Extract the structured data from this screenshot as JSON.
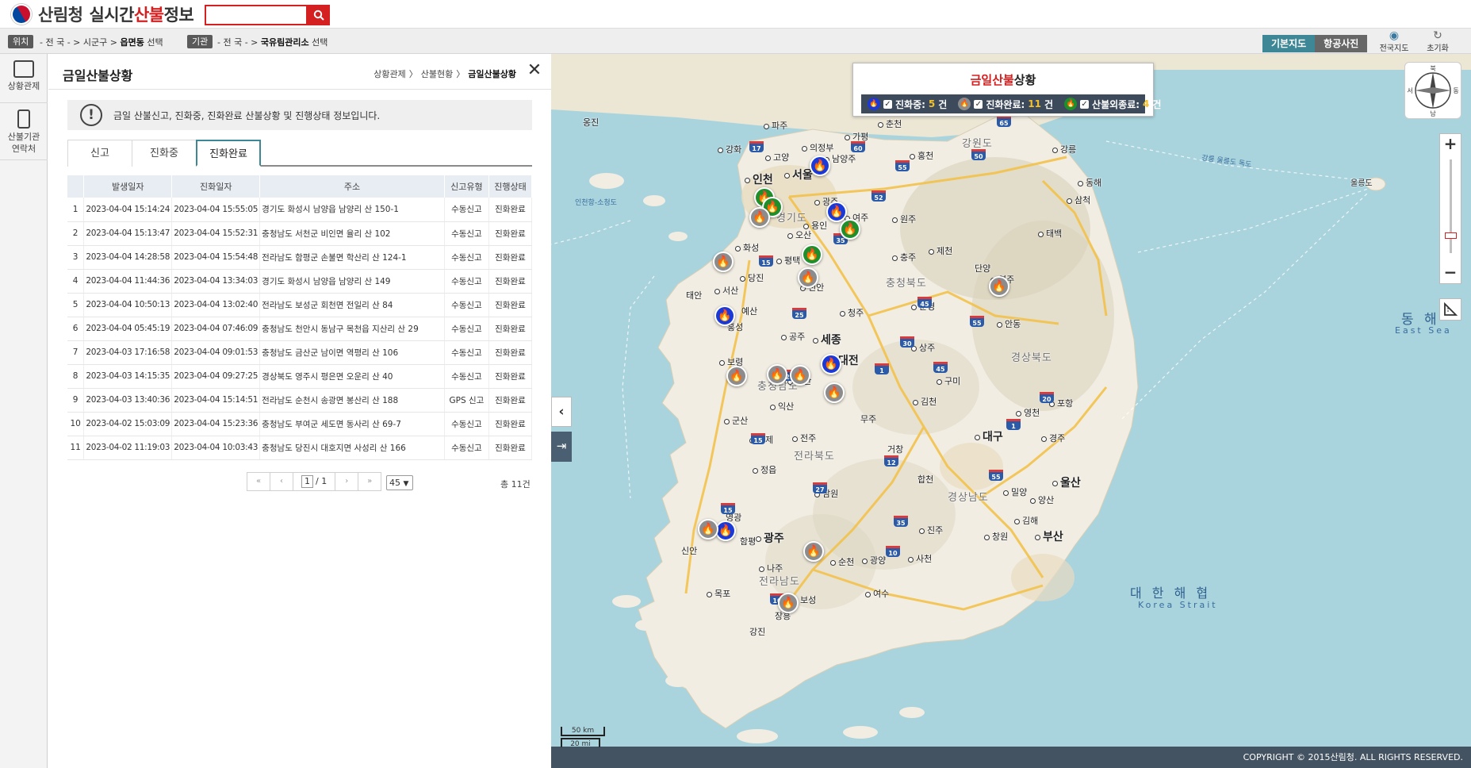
{
  "header": {
    "org": "산림청",
    "title_pre": "실시간",
    "title_red": "산불",
    "title_post": "정보",
    "search_placeholder": ""
  },
  "location_bar": {
    "location_tag": "위치",
    "location_text": "- 전 국 - > 시군구 > ",
    "location_bold": "읍면동",
    "location_suffix": " 선택",
    "agency_tag": "기관",
    "agency_text": "- 전 국 - > ",
    "agency_bold": "국유림관리소",
    "agency_suffix": " 선택",
    "map_basic": "기본지도",
    "map_aerial": "항공사진",
    "national_map": "전국지도",
    "reset": "초기화"
  },
  "left_nav": {
    "item1": "상황관제",
    "item2_line1": "산불기관",
    "item2_line2": "연락처"
  },
  "panel": {
    "title": "금일산불상황",
    "breadcrumb": [
      "상황관제",
      "산불현황",
      "금일산불상황"
    ],
    "notice": "금일 산불신고, 진화중, 진화완료 산불상황 및 진행상태 정보입니다.",
    "tabs": [
      "신고",
      "진화중",
      "진화완료"
    ],
    "active_tab": "진화완료",
    "columns": [
      "",
      "발생일자",
      "진화일자",
      "주소",
      "신고유형",
      "진행상태"
    ],
    "rows": [
      [
        "1",
        "2023-04-04 15:14:24",
        "2023-04-04 15:55:05",
        "경기도 화성시 남양읍 남양리 산 150-1",
        "수동신고",
        "진화완료"
      ],
      [
        "2",
        "2023-04-04 15:13:47",
        "2023-04-04 15:52:31",
        "충청남도 서천군 비인면 율리 산 102",
        "수동신고",
        "진화완료"
      ],
      [
        "3",
        "2023-04-04 14:28:58",
        "2023-04-04 15:54:48",
        "전라남도 함평군 손불면 학산리 산 124-1",
        "수동신고",
        "진화완료"
      ],
      [
        "4",
        "2023-04-04 11:44:36",
        "2023-04-04 13:34:03",
        "경기도 화성시 남양읍 남양리 산 149",
        "수동신고",
        "진화완료"
      ],
      [
        "5",
        "2023-04-04 10:50:13",
        "2023-04-04 13:02:40",
        "전라남도 보성군 회천면 전일리 산 84",
        "수동신고",
        "진화완료"
      ],
      [
        "6",
        "2023-04-04 05:45:19",
        "2023-04-04 07:46:09",
        "충청남도 천안시 동남구 목천읍 지산리 산 29",
        "수동신고",
        "진화완료"
      ],
      [
        "7",
        "2023-04-03 17:16:58",
        "2023-04-04 09:01:53",
        "충청남도 금산군 남이면 역평리 산 106",
        "수동신고",
        "진화완료"
      ],
      [
        "8",
        "2023-04-03 14:15:35",
        "2023-04-04 09:27:25",
        "경상북도 영주시 평은면 오운리 산 40",
        "수동신고",
        "진화완료"
      ],
      [
        "9",
        "2023-04-03 13:40:36",
        "2023-04-04 15:14:51",
        "전라남도 순천시 송광면 봉산리 산 188",
        "GPS 신고",
        "진화완료"
      ],
      [
        "10",
        "2023-04-02 15:03:09",
        "2023-04-04 15:23:36",
        "충청남도 부여군 세도면 동사리 산 69-7",
        "수동신고",
        "진화완료"
      ],
      [
        "11",
        "2023-04-02 11:19:03",
        "2023-04-04 10:03:43",
        "충청남도 당진시 대호지면 사성리 산 166",
        "수동신고",
        "진화완료"
      ]
    ],
    "pager": {
      "current": "1",
      "total_pages": "/ 1",
      "page_size": "45",
      "total_label": "총 11건"
    }
  },
  "map": {
    "legend": {
      "title_red": "금일산불",
      "title_post": "상황",
      "active_label": "진화중: ",
      "active_count": "5",
      "done_label": "진화완료: ",
      "done_count": "11",
      "other_label": "산불외종료: ",
      "other_count": "4",
      "unit": "건"
    },
    "compass_labels": [
      "북",
      "서",
      "동",
      "남"
    ],
    "scale_km": "50 km",
    "scale_mi": "20 mi",
    "copyright": "COPYRIGHT © 2015산림청. ALL RIGHTS RESERVED.",
    "colors": {
      "active": "#1a39d6",
      "done": "#8c8c8c",
      "other": "#1f8f2c",
      "accent": "#d42020",
      "teal": "#3e8796"
    },
    "labels": {
      "incheon": "인천",
      "seoul": "서울",
      "gyeonggi": "경기도",
      "gangwon": "강원도",
      "chungbuk": "충청북도",
      "chungnam": "충청남도",
      "sejong": "세종",
      "daejeon": "대전",
      "gyeongbuk": "경상북도",
      "daegu": "대구",
      "jeonbuk": "전라북도",
      "gyeongnam": "경상남도",
      "ulsan": "울산",
      "busan": "부산",
      "gwangju": "광주",
      "jeonnam": "전라남도",
      "paju": "파주",
      "goyang": "고양",
      "uijeongbu": "의정부",
      "namyangju": "남양주",
      "chuncheon": "춘천",
      "gapyeong": "가평",
      "hongcheon": "홍천",
      "gangneung": "강릉",
      "donghae": "동해",
      "samcheok": "삼척",
      "taebaek": "태백",
      "wonju": "원주",
      "yeoju": "여주",
      "gwangju_g": "광주",
      "yongin": "용인",
      "osan": "오산",
      "pyeongtaek": "평택",
      "cheonan": "천안",
      "dangjin": "당진",
      "seosan": "서산",
      "taean": "태안",
      "yesan": "예산",
      "hongseong": "홍성",
      "cheongju": "청주",
      "chungju": "충주",
      "jecheon": "제천",
      "danyang": "단양",
      "yeongju": "영주",
      "andong": "안동",
      "mungyeong": "문경",
      "sangju": "상주",
      "gumi": "구미",
      "gimcheon": "김천",
      "yeongcheon": "영천",
      "pohang": "포항",
      "gyeongju": "경주",
      "boryeong": "보령",
      "gongju": "공주",
      "nonsan": "논산",
      "iksan": "익산",
      "gunsan": "군산",
      "gimje": "김제",
      "jeonju": "전주",
      "jeongeup": "정읍",
      "namwon": "남원",
      "muju": "무주",
      "geochang": "거창",
      "hapcheon": "합천",
      "jinju": "진주",
      "sacheon": "사천",
      "changwon": "창원",
      "gimhae": "김해",
      "yangsan": "양산",
      "miryang": "밀양",
      "mokpo": "목포",
      "naju": "나주",
      "suncheon": "순천",
      "yeosu": "여수",
      "gwangyang": "광양",
      "hampyeong": "함평",
      "yeonggwang": "영광",
      "sinan": "신안",
      "boseong": "보성",
      "gangjin": "강진",
      "jangheung": "장흥",
      "hwaseong": "화성",
      "ongjin": "옹진",
      "ganghwa": "강화",
      "east_sea": "동 해",
      "east_sea_en": "East Sea",
      "korea_strait": "대 한 해 협",
      "korea_strait_en": "Korea Strait",
      "ulleungdo": "울릉도",
      "dokdo_line": "강릉 울릉도 독도",
      "incheon_sora": "인천항-소청도"
    }
  }
}
